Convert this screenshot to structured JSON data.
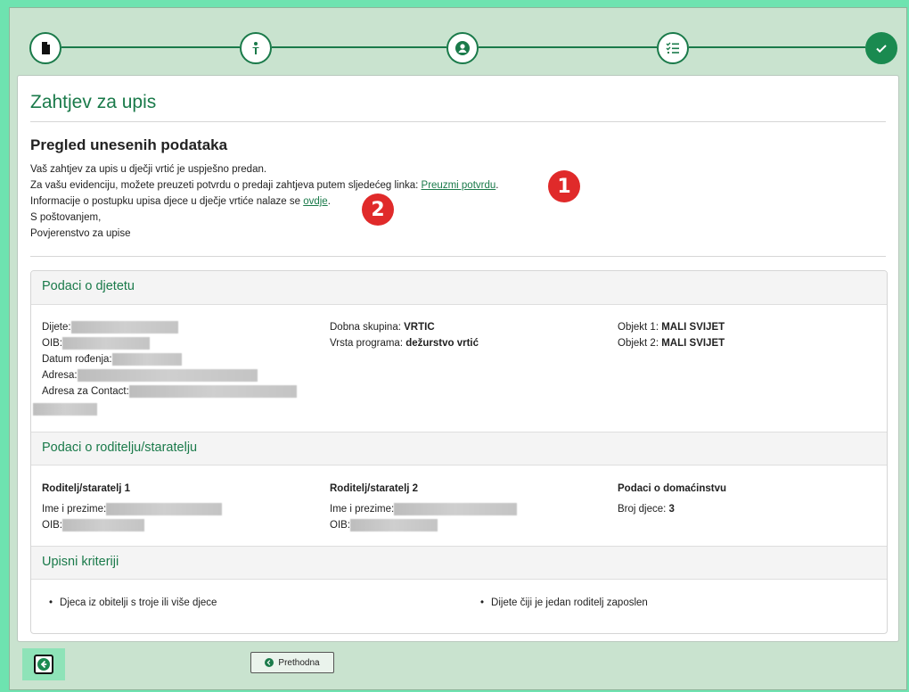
{
  "stepper": {
    "steps": [
      {
        "icon": "document-icon",
        "state": "done"
      },
      {
        "icon": "child-icon",
        "state": "done"
      },
      {
        "icon": "parent-icon",
        "state": "done"
      },
      {
        "icon": "checklist-icon",
        "state": "done"
      },
      {
        "icon": "check-icon",
        "state": "active"
      }
    ]
  },
  "page": {
    "title": "Zahtjev za upis",
    "review_title": "Pregled unesenih podataka",
    "line1": "Vaš zahtjev za upis u dječji vrtić je uspješno predan.",
    "line2_prefix": "Za vašu evidenciju, možete preuzeti potvrdu o predaji zahtjeva putem sljedećeg linka: ",
    "download_link": "Preuzmi potvrdu",
    "line2_suffix": ".",
    "line3_prefix": "Informacije o postupku upisa djece u dječje vrtiće nalaze se ",
    "info_link": "ovdje",
    "line3_suffix": ".",
    "line4": "S poštovanjem,",
    "line5": "Povjerenstvo za upise",
    "badge1": "1",
    "badge2": "2"
  },
  "child": {
    "heading": "Podaci o djetetu",
    "name_label": "Dijete:",
    "oib_label": "OIB:",
    "dob_label": "Datum rođenja:",
    "address_label": "Adresa:",
    "contact_address_label": "Adresa za Contact:",
    "age_group_label": "Dobna skupina: ",
    "age_group_value": "VRTIC",
    "program_label": "Vrsta programa: ",
    "program_value": "dežurstvo vrtić",
    "object1_label": "Objekt 1: ",
    "object1_value": "MALI SVIJET",
    "object2_label": "Objekt 2: ",
    "object2_value": "MALI SVIJET"
  },
  "parents": {
    "heading": "Podaci o roditelju/staratelju",
    "parent1_title": "Roditelj/staratelj 1",
    "parent2_title": "Roditelj/staratelj 2",
    "household_title": "Podaci o domaćinstvu",
    "name_label": "Ime i prezime:",
    "oib_label": "OIB:",
    "children_count_label": "Broj djece: ",
    "children_count_value": "3"
  },
  "criteria": {
    "heading": "Upisni kriteriji",
    "items": [
      "Djeca iz obitelji s troje ili više djece",
      "Dijete čiji je jedan roditelj zaposlen"
    ]
  },
  "footer": {
    "prev_label": "Prethodna"
  },
  "colors": {
    "accent": "#1a7a4a",
    "page_bg": "#c9e3cf",
    "badge": "#e02a2a"
  }
}
